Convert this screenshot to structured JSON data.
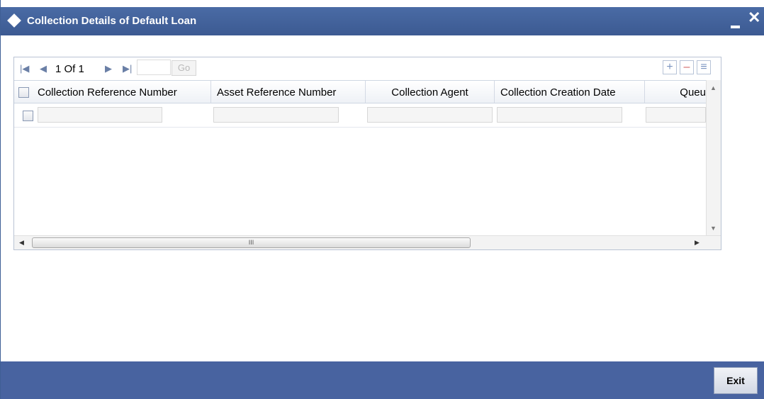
{
  "window": {
    "title": "Collection Details of Default Loan",
    "minimize_icon": "minimize-icon",
    "close_icon": "close-icon",
    "close_glyph": "✕"
  },
  "grid": {
    "pager": {
      "first_icon": "first-page-icon",
      "prev_icon": "previous-page-icon",
      "next_icon": "next-page-icon",
      "last_icon": "last-page-icon",
      "page_text": "1 Of 1",
      "page_input_value": "",
      "go_label": "Go"
    },
    "toolbar": {
      "add_glyph": "+",
      "delete_glyph": "–",
      "view_glyph": "≡"
    },
    "columns": [
      "Collection Reference Number",
      "Asset Reference Number",
      "Collection Agent",
      "Collection Creation Date",
      "Queu"
    ],
    "rows": [
      {
        "values": [
          "",
          "",
          "",
          "",
          ""
        ]
      }
    ],
    "hscroll_grip": "III"
  },
  "footer": {
    "exit_label": "Exit"
  },
  "colors": {
    "titlebar": "#4a6ba5",
    "footer": "#4863a0",
    "grid_border": "#b9c3d4"
  }
}
